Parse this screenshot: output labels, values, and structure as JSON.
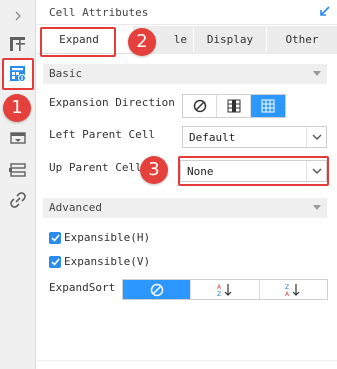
{
  "header": {
    "title": "Cell Attributes"
  },
  "tabs": [
    {
      "label": "Expand"
    },
    {
      "label": "le"
    },
    {
      "label": "Display"
    },
    {
      "label": "Other"
    }
  ],
  "sections": {
    "basic": "Basic",
    "advanced": "Advanced"
  },
  "fields": {
    "expansion_direction": "Expansion Direction",
    "left_parent_cell": "Left Parent Cell",
    "left_parent_value": "Default",
    "up_parent_cell": "Up Parent Cell",
    "up_parent_value": "None",
    "expandable_h": "Expansible(H)",
    "expandable_v": "Expansible(V)",
    "expand_sort": "ExpandSort"
  },
  "markers": [
    "1",
    "2",
    "3"
  ],
  "colors": {
    "accent": "#2b97ff",
    "highlight": "#e43b3b",
    "marker": "#e5413c"
  },
  "icons": [
    "arrow-right-icon",
    "cell-layout-icon",
    "cell-attributes-icon",
    "dropdown-widget-icon",
    "condition-icon",
    "hyperlink-icon",
    "corner-arrow-icon",
    "no-expand-icon",
    "vertical-expand-icon",
    "horizontal-expand-icon",
    "no-sort-icon",
    "sort-ascending-icon",
    "sort-descending-icon",
    "chevron-down-icon",
    "check-icon"
  ]
}
